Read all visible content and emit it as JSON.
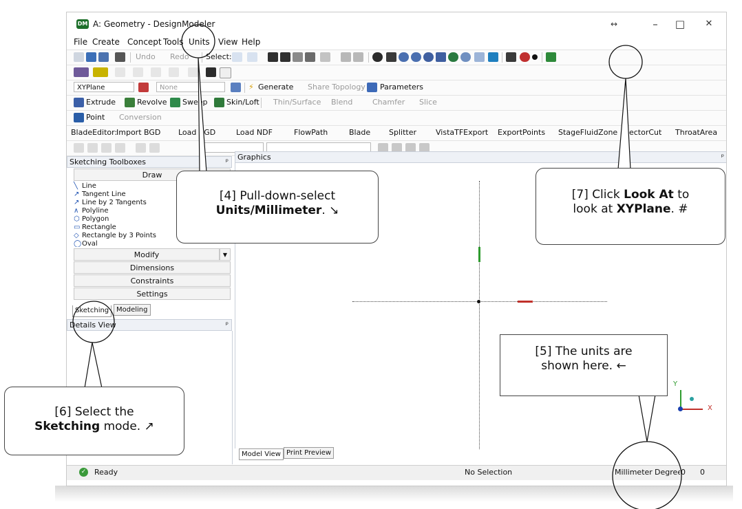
{
  "window": {
    "title": "A: Geometry - DesignModeler",
    "app_badge": "DM",
    "controls": {
      "resize": "↔",
      "minimize": "–",
      "maximize": "□",
      "close": "✕"
    }
  },
  "menu": [
    "File",
    "Create",
    "Concept",
    "Tools",
    "Units",
    "View",
    "Help"
  ],
  "toolbar1": {
    "undo": "Undo",
    "redo": "Redo",
    "select": "Select:"
  },
  "toolbar3": {
    "plane": "XYPlane",
    "sketch": "None",
    "generate": "Generate",
    "share_topology": "Share Topology",
    "parameters": "Parameters"
  },
  "toolbar4": {
    "extrude": "Extrude",
    "revolve": "Revolve",
    "sweep": "Sweep",
    "skin_loft": "Skin/Loft",
    "thin_surface": "Thin/Surface",
    "blend": "Blend",
    "chamfer": "Chamfer",
    "slice": "Slice"
  },
  "toolbar5": {
    "point": "Point",
    "conversion": "Conversion"
  },
  "toolbar6": {
    "label": "BladeEditor:",
    "items": [
      "Import BGD",
      "Load BGD",
      "Load NDF",
      "FlowPath",
      "Blade",
      "Splitter",
      "VistaTFExport",
      "ExportPoints",
      "StageFluidZone",
      "SectorCut",
      "ThroatArea"
    ]
  },
  "sketching_toolboxes": {
    "title": "Sketching Toolboxes",
    "pin": "ᵖ",
    "draw": "Draw",
    "tools": [
      "Line",
      "Tangent Line",
      "Line by 2 Tangents",
      "Polyline",
      "Polygon",
      "Rectangle",
      "Rectangle by 3 Points",
      "Oval"
    ],
    "modify": "Modify",
    "dimensions": "Dimensions",
    "constraints": "Constraints",
    "settings": "Settings",
    "tabs": [
      "Sketching",
      "Modeling"
    ]
  },
  "details_view": {
    "title": "Details View"
  },
  "graphics": {
    "title": "Graphics",
    "tabs": [
      "Model View",
      "Print Preview"
    ],
    "axis_y": "Y",
    "axis_x": "X"
  },
  "status": {
    "ready": "Ready",
    "selection": "No Selection",
    "units": "Millimeter",
    "angle": "Degree",
    "v1": "0",
    "v2": "0"
  },
  "callouts": {
    "c4": {
      "pre": "[4] Pull-down-select",
      "bold": "Units/Millimeter",
      "post": ". ↘"
    },
    "c5": {
      "line1": "[5] The units are",
      "line2": "shown here.  ←"
    },
    "c6": {
      "pre": "[6] Select the",
      "bold": "Sketching",
      "post": " mode.  ↗"
    },
    "c7": {
      "pre": "[7] Click ",
      "bold1": "Look At",
      "mid1": " to",
      "mid2": "look at ",
      "bold2": "XYPlane",
      "post": ".  #"
    }
  },
  "colors": {
    "accent": "#1a4fb0",
    "axis_x": "#c0302a",
    "axis_y": "#2e9b2e"
  }
}
